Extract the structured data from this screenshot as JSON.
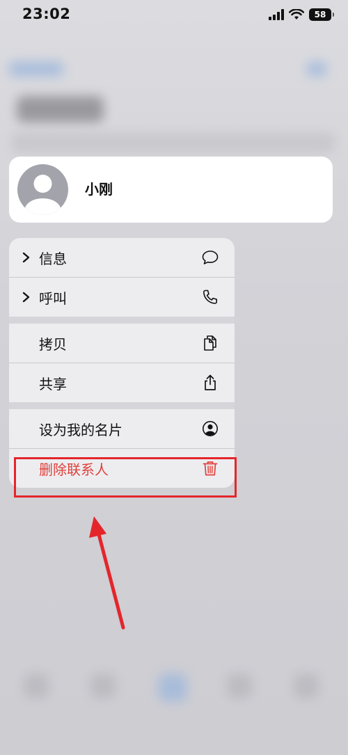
{
  "status_bar": {
    "time": "23:02",
    "battery": "58"
  },
  "contact": {
    "name": "小刚"
  },
  "menu": {
    "items": [
      {
        "label": "信息",
        "icon": "message-bubble-icon",
        "submenu": true
      },
      {
        "label": "呼叫",
        "icon": "phone-icon",
        "submenu": true
      },
      {
        "label": "拷贝",
        "icon": "copy-icon",
        "submenu": false
      },
      {
        "label": "共享",
        "icon": "share-icon",
        "submenu": false
      },
      {
        "label": "设为我的名片",
        "icon": "person-circle-icon",
        "submenu": false
      },
      {
        "label": "删除联系人",
        "icon": "trash-icon",
        "submenu": false,
        "destructive": true
      }
    ]
  },
  "colors": {
    "destructive": "#e0413a",
    "annotation": "#e4262b"
  }
}
